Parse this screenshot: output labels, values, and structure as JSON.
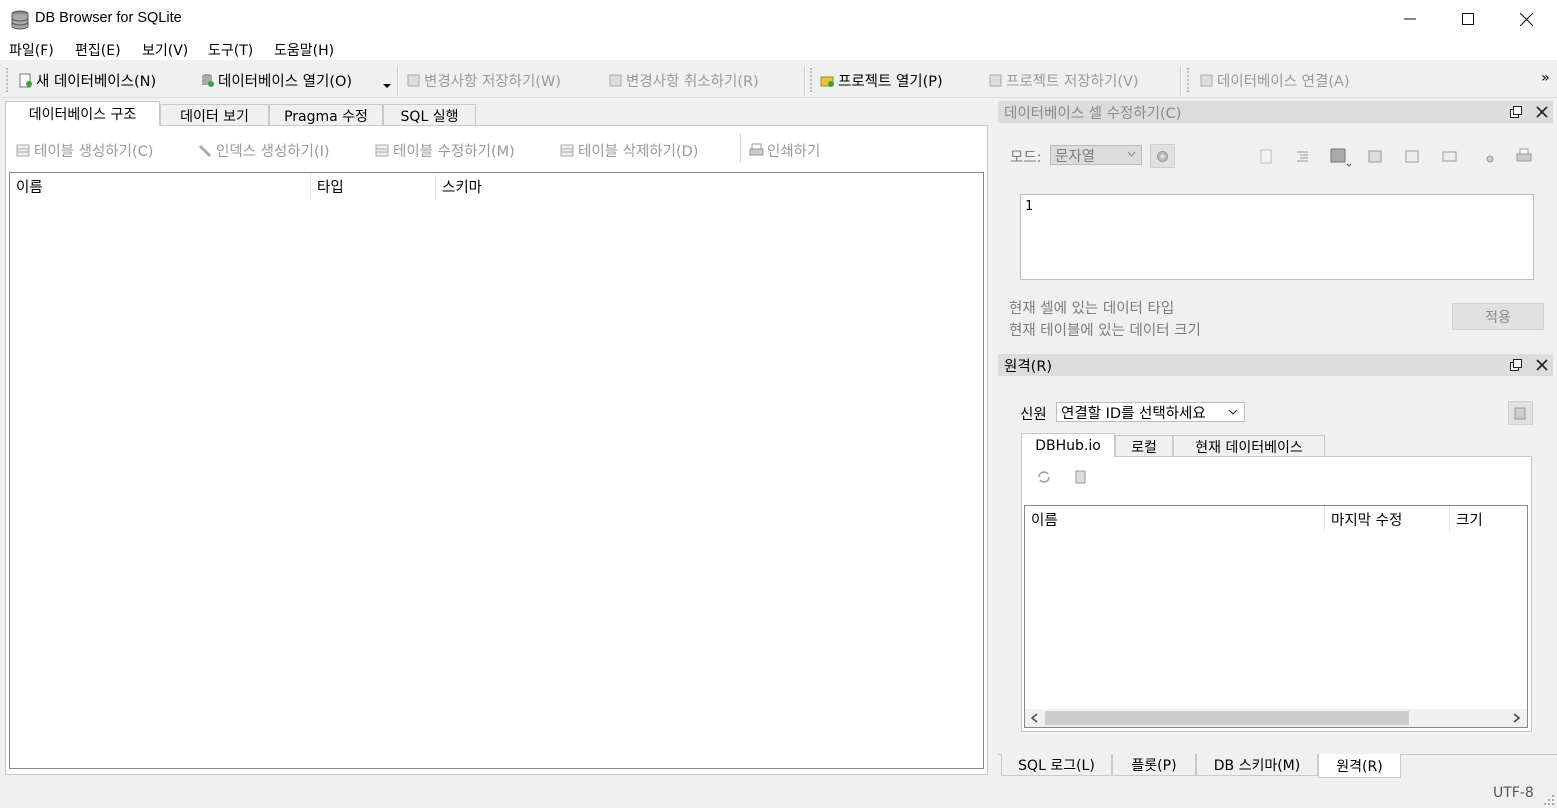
{
  "window": {
    "title": "DB Browser for SQLite"
  },
  "menu": [
    "파일(F)",
    "편집(E)",
    "보기(V)",
    "도구(T)",
    "도움말(H)"
  ],
  "toolbar": {
    "new_db": "새 데이터베이스(N)",
    "open_db": "데이터베이스 열기(O)",
    "write_changes": "변경사항 저장하기(W)",
    "revert_changes": "변경사항 취소하기(R)",
    "open_project": "프로젝트 열기(P)",
    "save_project": "프로젝트 저장하기(V)",
    "attach_db": "데이터베이스 연결(A)",
    "overflow": "»"
  },
  "main_tabs": [
    "데이터베이스 구조",
    "데이터 보기",
    "Pragma 수정",
    "SQL 실행"
  ],
  "structure_toolbar": {
    "create_table": "테이블 생성하기(C)",
    "create_index": "인덱스 생성하기(I)",
    "modify_table": "테이블 수정하기(M)",
    "delete_table": "테이블 삭제하기(D)",
    "print": "인쇄하기"
  },
  "structure_columns": [
    "이름",
    "타입",
    "스키마"
  ],
  "edit_cell": {
    "title": "데이터베이스 셀 수정하기(C)",
    "mode_label": "모드:",
    "mode_value": "문자열",
    "cell_value": "1",
    "type_info": "현재 셀에 있는 데이터 타입",
    "size_info": "현재 테이블에 있는 데이터 크기",
    "apply": "적용"
  },
  "remote": {
    "title": "원격(R)",
    "identity_label": "신원",
    "identity_value": "연결할 ID를 선택하세요",
    "tabs": [
      "DBHub.io",
      "로컬",
      "현재 데이터베이스"
    ],
    "columns": [
      "이름",
      "마지막 수정",
      "크기"
    ]
  },
  "bottom_tabs": [
    "SQL 로그(L)",
    "플롯(P)",
    "DB 스키마(M)",
    "원격(R)"
  ],
  "status": {
    "encoding": "UTF-8"
  }
}
